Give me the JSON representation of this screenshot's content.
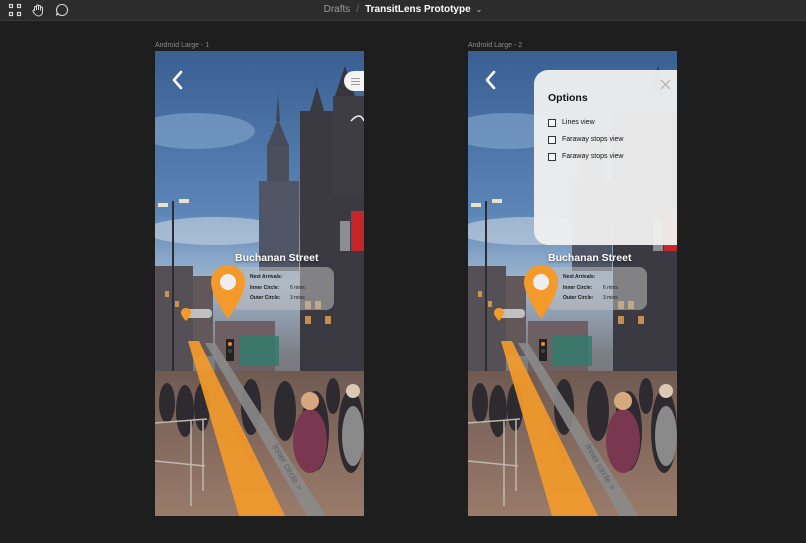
{
  "toolbar": {
    "breadcrumb_parent": "Drafts",
    "separator": "/",
    "file_name": "TransitLens Prototype",
    "file_menu_chevron": "⌄",
    "tools": [
      "frame-tool-icon",
      "hand-tool-icon",
      "comment-tool-icon"
    ]
  },
  "frames": [
    {
      "label": "Android Large - 1",
      "street": "Buchanan Street",
      "arrivals_heading": "Next Arrivals:",
      "rows": [
        {
          "line": "Inner Circle:",
          "time": "6 mins"
        },
        {
          "line": "Outer Circle:",
          "time": "3 mins"
        }
      ],
      "path_labels": {
        "outer": "< Outer circle",
        "inner": "Inner circle >"
      }
    },
    {
      "label": "Android Large - 2",
      "street": "Buchanan Street",
      "arrivals_heading": "Next Arrivals:",
      "rows": [
        {
          "line": "Inner Circle:",
          "time": "6 mins"
        },
        {
          "line": "Outer Circle:",
          "time": "3 mins"
        }
      ],
      "path_labels": {
        "outer": "< Outer circle",
        "inner": "Inner circle >"
      }
    }
  ],
  "options": {
    "title": "Options",
    "items": [
      {
        "label": "Lines view",
        "checked": false
      },
      {
        "label": "Faraway stops view",
        "checked": false
      },
      {
        "label": "Faraway stops view",
        "checked": false
      }
    ]
  },
  "colors": {
    "canvas": "#1e1e1e",
    "toolbar": "#2c2c2c",
    "accent_orange": "#f39a2b",
    "inner_path_gray": "#8a8a8a"
  }
}
